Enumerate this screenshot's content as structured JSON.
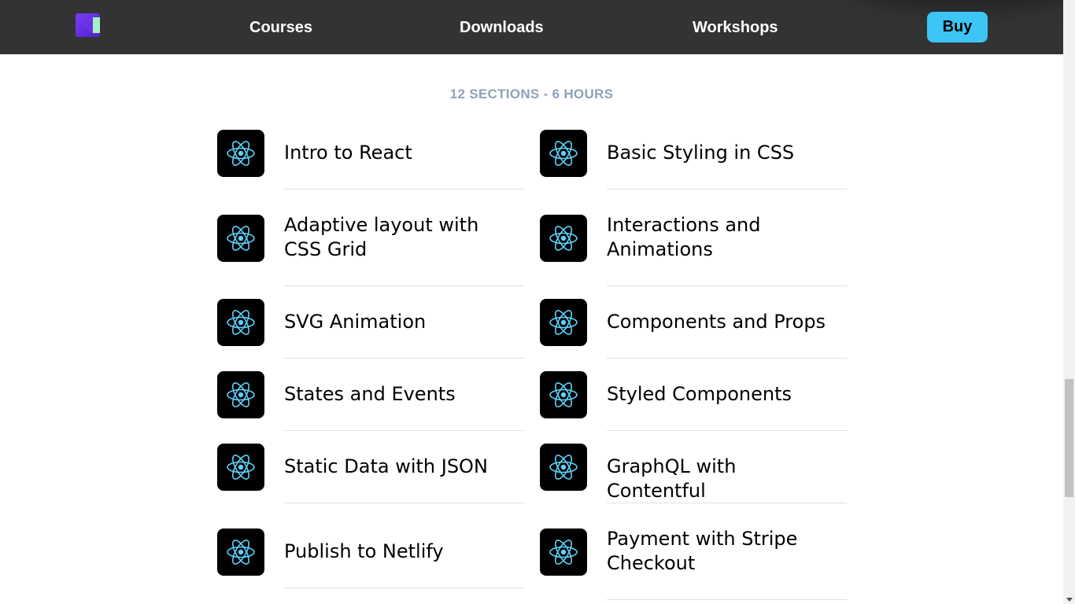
{
  "nav": {
    "logo_icon": "kt-brand-logo-icon",
    "links": [
      "Courses",
      "Downloads",
      "Workshops"
    ],
    "buy_label": "Buy",
    "colors": {
      "bar": "#333333",
      "buy": "#3cc5f5"
    }
  },
  "course": {
    "sections_heading": "12 SECTIONS - 6 HOURS",
    "item_icon": "react-atom-icon",
    "sections": [
      "Intro to React",
      "Basic Styling in CSS",
      "Adaptive layout with CSS Grid",
      "Interactions and Animations",
      "SVG Animation",
      "Components and Props",
      "States and Events",
      "Styled Components",
      "Static Data with JSON",
      "GraphQL with Contentful",
      "Publish to Netlify",
      "Payment with Stripe Checkout"
    ]
  }
}
